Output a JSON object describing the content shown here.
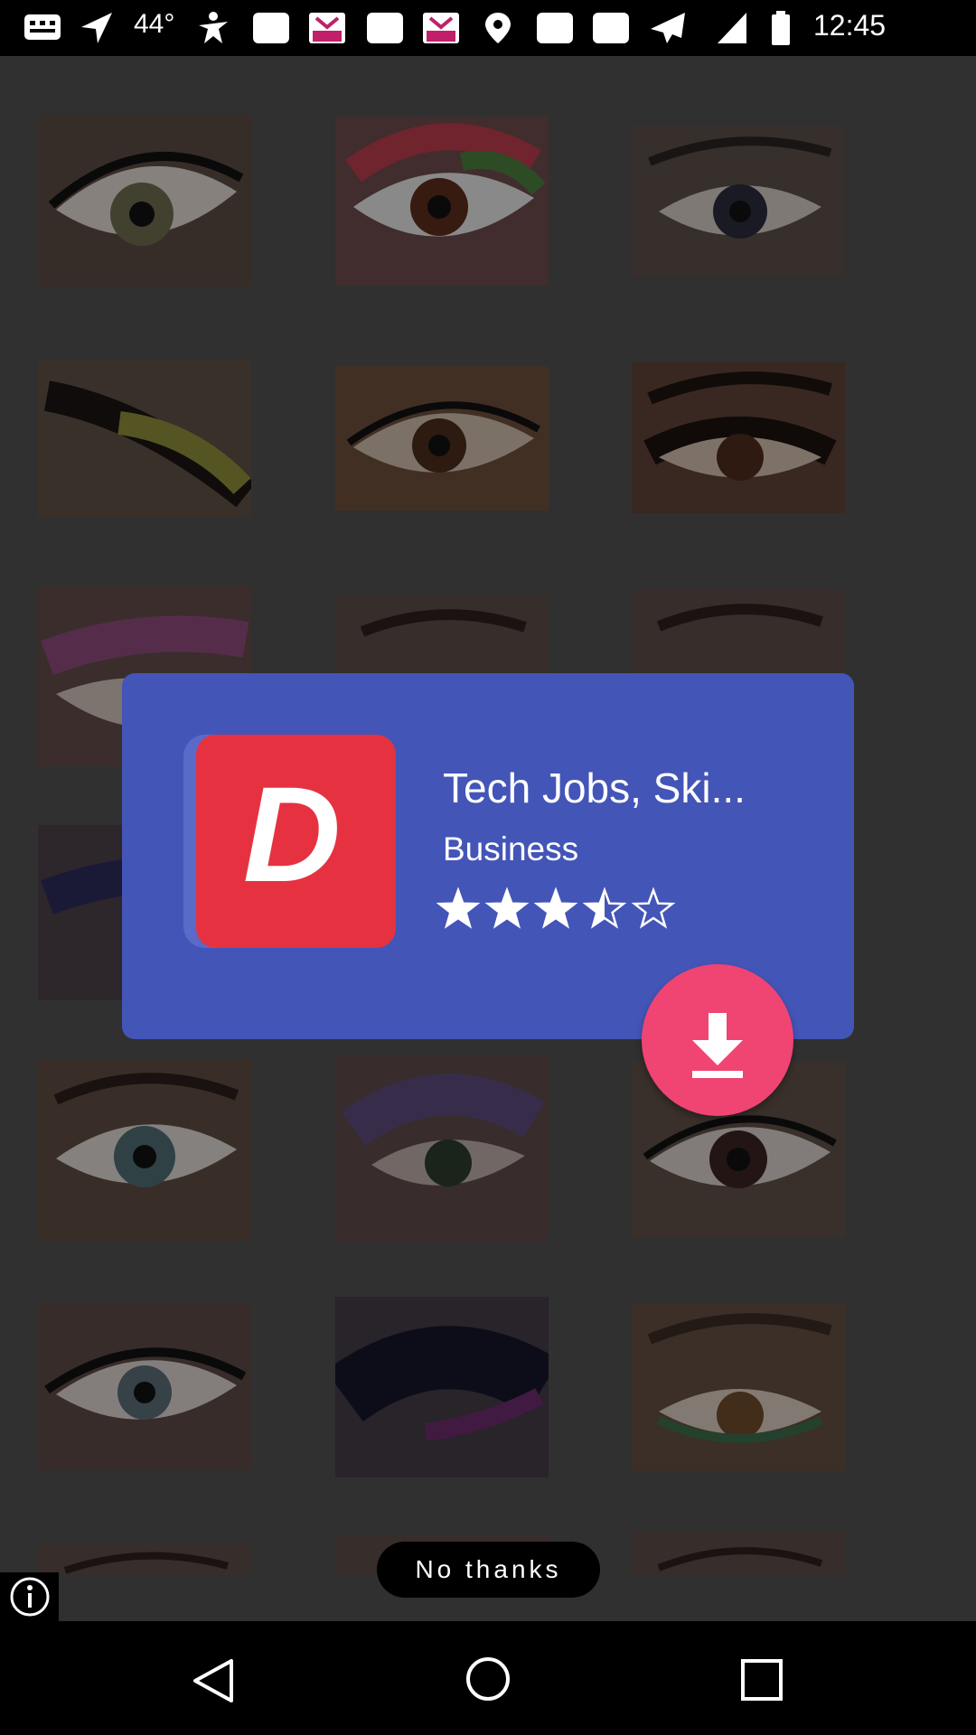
{
  "status_bar": {
    "temperature": "44°",
    "time": "12:45",
    "icons": [
      "message-icon",
      "navigation-icon",
      "figure-icon",
      "square-icon",
      "popapp-icon",
      "square-icon",
      "popapp-icon",
      "location-icon",
      "square-icon",
      "square-icon",
      "send-icon",
      "signal-icon",
      "battery-icon"
    ]
  },
  "ad": {
    "app_logo_letter": "D",
    "app_title": "Tech Jobs, Ski...",
    "category": "Business",
    "rating": 3.5,
    "rating_max": 5,
    "download_icon": "download-icon",
    "no_thanks_label": "No thanks",
    "info_icon": "info-icon",
    "colors": {
      "card": "#4455b8",
      "download_button": "#f04473",
      "logo_red": "#e63240"
    }
  },
  "nav": {
    "back_icon": "back-icon",
    "home_icon": "home-icon",
    "recents_icon": "recents-icon"
  }
}
